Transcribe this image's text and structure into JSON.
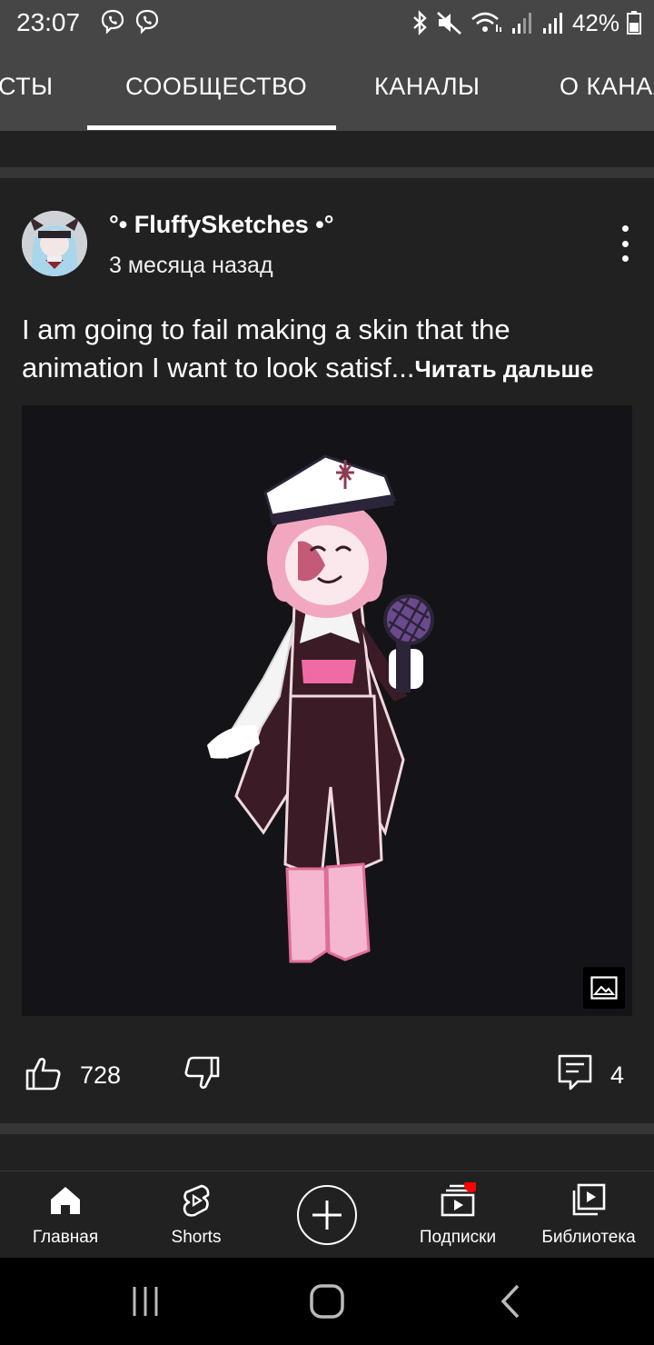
{
  "status_bar": {
    "time": "23:07",
    "battery_percent": "42%",
    "icons": [
      "viber-icon",
      "viber-icon",
      "bluetooth-icon",
      "mute-icon",
      "wifi-icon",
      "signal-icon",
      "signal-icon",
      "battery-icon"
    ]
  },
  "tabs": [
    {
      "label": "СТЫ",
      "active": false
    },
    {
      "label": "СООБЩЕСТВО",
      "active": true
    },
    {
      "label": "КАНАЛЫ",
      "active": false
    },
    {
      "label": "О КАНАЛЕ",
      "active": false
    }
  ],
  "post": {
    "author": "°• FluffySketches •°",
    "time_ago": "3 месяца назад",
    "text": "I am going to fail making a skin that the animation I want to look satisf...",
    "read_more": "Читать дальше",
    "likes": "728",
    "comments": "4"
  },
  "bottom_nav": [
    {
      "label": "Главная",
      "icon": "home-icon"
    },
    {
      "label": "Shorts",
      "icon": "shorts-icon"
    },
    {
      "label": "",
      "icon": "create-icon"
    },
    {
      "label": "Подписки",
      "icon": "subscriptions-icon",
      "badge": true
    },
    {
      "label": "Библиотека",
      "icon": "library-icon"
    }
  ],
  "colors": {
    "header_bg": "#464646",
    "feed_bg": "#212121",
    "divider": "#363636",
    "notification_dot": "#ff0000"
  }
}
